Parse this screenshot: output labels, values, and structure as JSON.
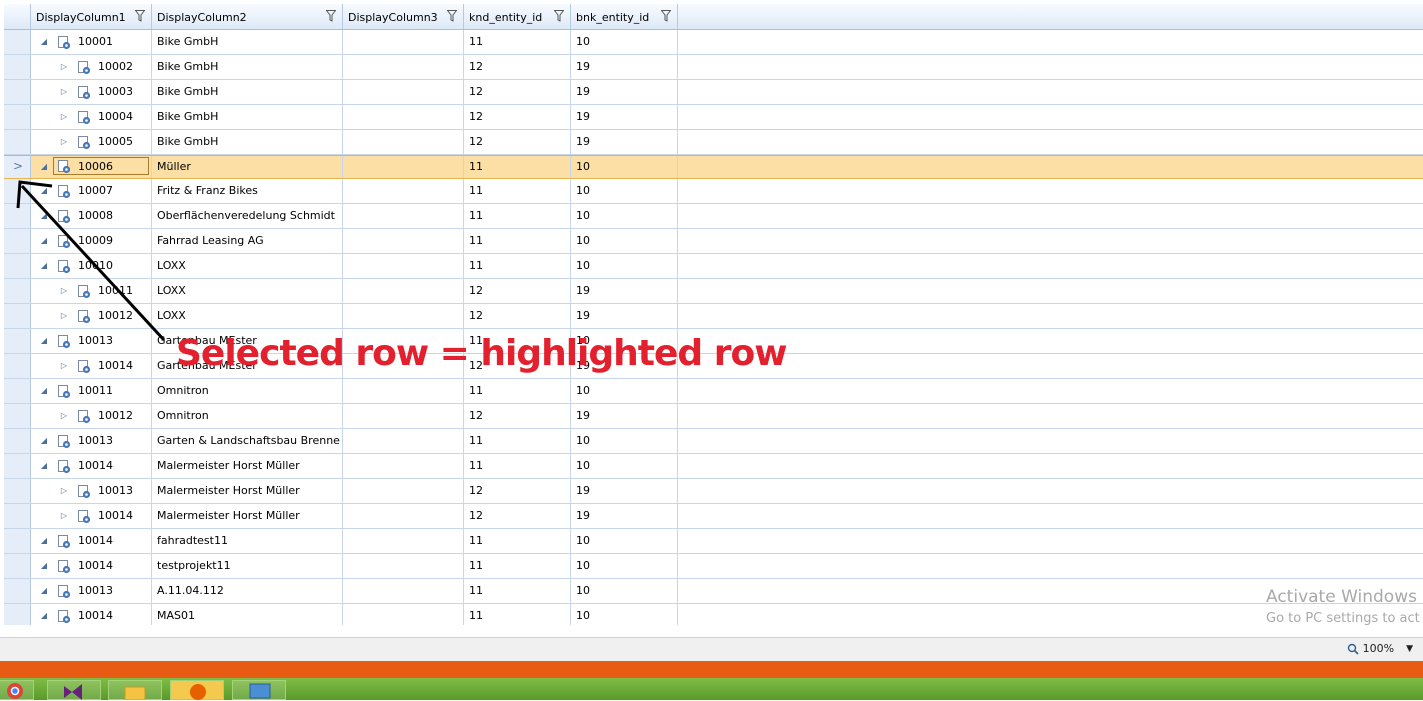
{
  "columns": [
    {
      "label": "DisplayColumn1"
    },
    {
      "label": "DisplayColumn2"
    },
    {
      "label": "DisplayColumn3"
    },
    {
      "label": "knd_entity_id"
    },
    {
      "label": "bnk_entity_id"
    }
  ],
  "rows": [
    {
      "id": "10001",
      "name": "Bike GmbH",
      "knd": "11",
      "bnk": "10",
      "level": 0,
      "expanded": true
    },
    {
      "id": "10002",
      "name": "Bike GmbH",
      "knd": "12",
      "bnk": "19",
      "level": 1,
      "expanded": false
    },
    {
      "id": "10003",
      "name": "Bike GmbH",
      "knd": "12",
      "bnk": "19",
      "level": 1,
      "expanded": false
    },
    {
      "id": "10004",
      "name": "Bike GmbH",
      "knd": "12",
      "bnk": "19",
      "level": 1,
      "expanded": false
    },
    {
      "id": "10005",
      "name": "Bike GmbH",
      "knd": "12",
      "bnk": "19",
      "level": 1,
      "expanded": false
    },
    {
      "id": "10006",
      "name": "Müller",
      "knd": "11",
      "bnk": "10",
      "level": 0,
      "expanded": true,
      "selected": true
    },
    {
      "id": "10007",
      "name": "Fritz & Franz Bikes",
      "knd": "11",
      "bnk": "10",
      "level": 0,
      "expanded": true
    },
    {
      "id": "10008",
      "name": "Oberflächenveredelung Schmidt",
      "knd": "11",
      "bnk": "10",
      "level": 0,
      "expanded": true
    },
    {
      "id": "10009",
      "name": "Fahrrad Leasing AG",
      "knd": "11",
      "bnk": "10",
      "level": 0,
      "expanded": true
    },
    {
      "id": "10010",
      "name": "LOXX",
      "knd": "11",
      "bnk": "10",
      "level": 0,
      "expanded": true
    },
    {
      "id": "10011",
      "name": "LOXX",
      "knd": "12",
      "bnk": "19",
      "level": 1,
      "expanded": false
    },
    {
      "id": "10012",
      "name": "LOXX",
      "knd": "12",
      "bnk": "19",
      "level": 1,
      "expanded": false
    },
    {
      "id": "10013",
      "name": "Gartenbau MEster",
      "knd": "11",
      "bnk": "10",
      "level": 0,
      "expanded": true
    },
    {
      "id": "10014",
      "name": "Gartenbau MEster",
      "knd": "12",
      "bnk": "19",
      "level": 1,
      "expanded": false
    },
    {
      "id": "10011",
      "name": "Omnitron",
      "knd": "11",
      "bnk": "10",
      "level": 0,
      "expanded": true
    },
    {
      "id": "10012",
      "name": "Omnitron",
      "knd": "12",
      "bnk": "19",
      "level": 1,
      "expanded": false
    },
    {
      "id": "10013",
      "name": "Garten & Landschaftsbau Brenne",
      "knd": "11",
      "bnk": "10",
      "level": 0,
      "expanded": true
    },
    {
      "id": "10014",
      "name": "Malermeister Horst Müller",
      "knd": "11",
      "bnk": "10",
      "level": 0,
      "expanded": true
    },
    {
      "id": "10013",
      "name": "Malermeister Horst Müller",
      "knd": "12",
      "bnk": "19",
      "level": 1,
      "expanded": false
    },
    {
      "id": "10014",
      "name": "Malermeister Horst Müller",
      "knd": "12",
      "bnk": "19",
      "level": 1,
      "expanded": false
    },
    {
      "id": "10014",
      "name": "fahradtest11",
      "knd": "11",
      "bnk": "10",
      "level": 0,
      "expanded": true
    },
    {
      "id": "10014",
      "name": "testprojekt11",
      "knd": "11",
      "bnk": "10",
      "level": 0,
      "expanded": true
    },
    {
      "id": "10013",
      "name": "A.11.04.112",
      "knd": "11",
      "bnk": "10",
      "level": 0,
      "expanded": true
    },
    {
      "id": "10014",
      "name": "MAS01",
      "knd": "11",
      "bnk": "10",
      "level": 0,
      "expanded": true
    }
  ],
  "annotation": {
    "text": "Selected row = highlighted row"
  },
  "statusbar": {
    "zoom": "100%"
  },
  "watermark": {
    "line1": "Activate Windows",
    "line2": "Go to PC settings to act"
  },
  "colors": {
    "selected_row": "#fbdfa5",
    "annotation": "#e3202e",
    "taskbar": "#6aaa35"
  }
}
